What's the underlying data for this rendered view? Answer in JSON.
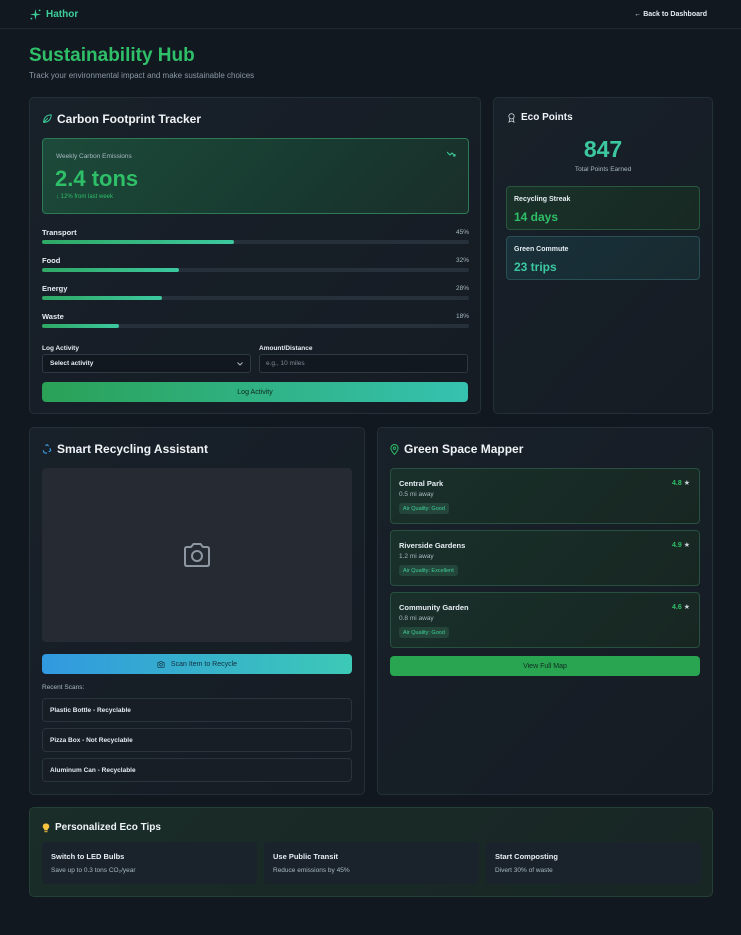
{
  "topbar": {
    "brand": "Hathor",
    "back_link": "← Back to Dashboard"
  },
  "header": {
    "title": "Sustainability Hub",
    "subtitle": "Track your environmental impact and make sustainable choices"
  },
  "carbon": {
    "title": "Carbon Footprint Tracker",
    "emissions": {
      "label": "Weekly Carbon Emissions",
      "value": "2.4 tons",
      "change": "↓ 12% from last week",
      "trend_icon": "trending-down-icon"
    },
    "breakdown": [
      {
        "label": "Transport",
        "percent_text": "45%",
        "percent": 45
      },
      {
        "label": "Food",
        "percent_text": "32%",
        "percent": 32
      },
      {
        "label": "Energy",
        "percent_text": "28%",
        "percent": 28
      },
      {
        "label": "Waste",
        "percent_text": "18%",
        "percent": 18
      }
    ],
    "form": {
      "activity_label": "Log Activity",
      "activity_selected": "Select activity",
      "amount_label": "Amount/Distance",
      "amount_value": "",
      "amount_placeholder": "e.g., 10 miles",
      "submit_label": "Log Activity"
    }
  },
  "eco_points": {
    "title": "Eco Points",
    "points": "847",
    "points_label": "Total Points Earned",
    "stats": [
      {
        "label": "Recycling Streak",
        "value": "14 days",
        "color": "#2fbf68"
      },
      {
        "label": "Green Commute",
        "value": "23 trips",
        "color": "#3cc9a0"
      }
    ]
  },
  "recycling": {
    "title": "Smart Recycling Assistant",
    "scan_label": "Scan Item to Recycle",
    "recent_label": "Recent Scans:",
    "recent": [
      "Plastic Bottle - Recyclable",
      "Pizza Box - Not Recyclable",
      "Aluminum Can - Recyclable"
    ]
  },
  "green_space": {
    "title": "Green Space Mapper",
    "parks": [
      {
        "name": "Central Park",
        "distance": "0.5 mi away",
        "rating": "4.8",
        "air": "Air Quality: Good"
      },
      {
        "name": "Riverside Gardens",
        "distance": "1.2 mi away",
        "rating": "4.9",
        "air": "Air Quality: Excellent"
      },
      {
        "name": "Community Garden",
        "distance": "0.8 mi away",
        "rating": "4.6",
        "air": "Air Quality: Good"
      }
    ],
    "map_button": "View Full Map"
  },
  "tips": {
    "title": "Personalized Eco Tips",
    "items": [
      {
        "title": "Switch to LED Bulbs",
        "text": "Save up to 0.3 tons CO₂/year"
      },
      {
        "title": "Use Public Transit",
        "text": "Reduce emissions by 45%"
      },
      {
        "title": "Start Composting",
        "text": "Divert 30% of waste"
      }
    ]
  }
}
